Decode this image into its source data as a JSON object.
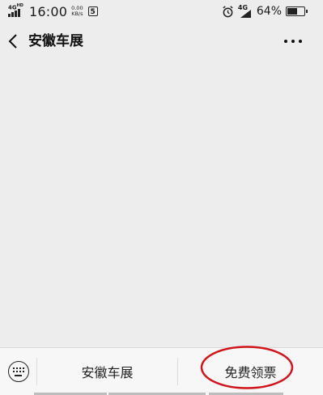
{
  "status_bar": {
    "network_left": "4G",
    "network_left_sup": "HD",
    "time": "16:00",
    "net_speed_value": "0.00",
    "net_speed_unit": "KB/s",
    "app_badge": "5",
    "network_right": "4G",
    "battery_percent": "64%",
    "battery_level": 0.64
  },
  "nav": {
    "title": "安徽车展",
    "back_icon": "chevron-left-icon",
    "more_icon": "more-dots-icon"
  },
  "bottom_menu": {
    "keyboard_icon": "keyboard-icon",
    "items": [
      {
        "label": "安徽车展"
      },
      {
        "label": "免费领票"
      }
    ],
    "annotation_color": "#d0141c"
  }
}
